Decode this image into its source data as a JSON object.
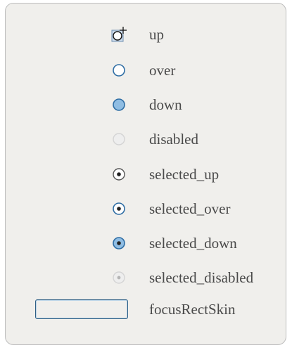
{
  "states": [
    {
      "label": "up",
      "icon": "radio-up-icon"
    },
    {
      "label": "over",
      "icon": "radio-over-icon"
    },
    {
      "label": "down",
      "icon": "radio-down-icon"
    },
    {
      "label": "disabled",
      "icon": "radio-disabled-icon"
    },
    {
      "label": "selected_up",
      "icon": "radio-selected-up-icon"
    },
    {
      "label": "selected_over",
      "icon": "radio-selected-over-icon"
    },
    {
      "label": "selected_down",
      "icon": "radio-selected-down-icon"
    },
    {
      "label": "selected_disabled",
      "icon": "radio-selected-disabled-icon"
    }
  ],
  "focus": {
    "label": "focusRectSkin",
    "icon": "focus-rect-icon"
  },
  "colors": {
    "panel_bg": "#f0efec",
    "panel_border": "#bdbdbd",
    "ring_blue": "#2e6da4",
    "down_fill": "#8fbde3",
    "disabled_ring": "#d4d4d4",
    "dot_dark": "#222222",
    "dot_disabled": "#b5b5b5"
  }
}
